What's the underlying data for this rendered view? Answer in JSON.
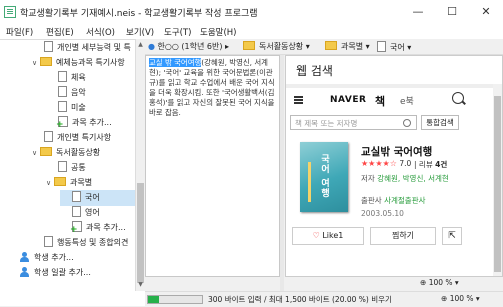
{
  "window": {
    "title": "학교생활기록부 기재예시.neis - 학교생활기록부 작성 프로그램",
    "minimize": "—",
    "maximize": "☐",
    "close": "✕"
  },
  "menu": [
    "파일(F)",
    "편집(E)",
    "서식(O)",
    "보기(V)",
    "도구(T)",
    "도움말(H)"
  ],
  "tree": {
    "items": [
      {
        "label": "개인별 세부능력 및 특",
        "icon": "doc"
      },
      {
        "label": "예체능과목 특기사항",
        "icon": "folder",
        "chev": "∨"
      },
      {
        "label": "체육",
        "icon": "doc"
      },
      {
        "label": "음악",
        "icon": "doc"
      },
      {
        "label": "미술",
        "icon": "doc"
      },
      {
        "label": "과목 추가...",
        "icon": "doc-add"
      },
      {
        "label": "개인별 특기사항",
        "icon": "doc"
      },
      {
        "label": "독서활동상황",
        "icon": "folder",
        "chev": "∨"
      },
      {
        "label": "공통",
        "icon": "doc"
      },
      {
        "label": "과목별",
        "icon": "folder",
        "chev": "∨"
      },
      {
        "label": "국어",
        "icon": "doc",
        "selected": true
      },
      {
        "label": "영어",
        "icon": "doc"
      },
      {
        "label": "과목 추가...",
        "icon": "doc-add"
      },
      {
        "label": "행동특성 및 종합의견",
        "icon": "doc"
      },
      {
        "label": "학생 추가...",
        "icon": "user",
        "chev": "›"
      },
      {
        "label": "학생 일괄 추가...",
        "icon": "user",
        "chev": "›"
      }
    ]
  },
  "breadcrumb": {
    "student": "한○○ (1학년 6반)",
    "section": "독서활동상황",
    "subsection": "과목별",
    "subject": "국어"
  },
  "editor": {
    "highlight": "교실 밖 국어여행",
    "body": "(강혜원, 박영신, 서계현); '국어' 교육을 위한 국어문법론(이관규)를 읽고 학교 수업에서 배운 국어 지식을 더욱 확장시킴. 또한 '국어생활백서(김홍석)'를 읽고 자신의 잘못된 국어 지식을 바로 잡음."
  },
  "web": {
    "title": "웹 검색",
    "brand": "NAVER",
    "section": "책",
    "tab": "e북",
    "search_placeholder": "책 제목 또는 저자명",
    "integrated_search": "통합검색",
    "book": {
      "title": "교실밖 국어여행",
      "cover_text": "국어 여행",
      "stars": "★★★★☆",
      "rating": "7.0",
      "review_label": "리뷰",
      "review_count": "4건",
      "author_prefix": "저자 ",
      "authors": "강혜원, 박영신, 서계현",
      "publisher_prefix": "출판사 ",
      "publisher": "사계절출판사",
      "date": "2003.05.10"
    },
    "like_label": "Like1",
    "like_icon": "♡",
    "share_label": "찜하기",
    "ext_icon": "⇱",
    "zoom": "100 %"
  },
  "status": {
    "progress_fraction": 0.2,
    "text": "300 바이트 입력 / 최대 1,500 바이트 (20.00 %) 비우기",
    "zoom": "100 %"
  }
}
